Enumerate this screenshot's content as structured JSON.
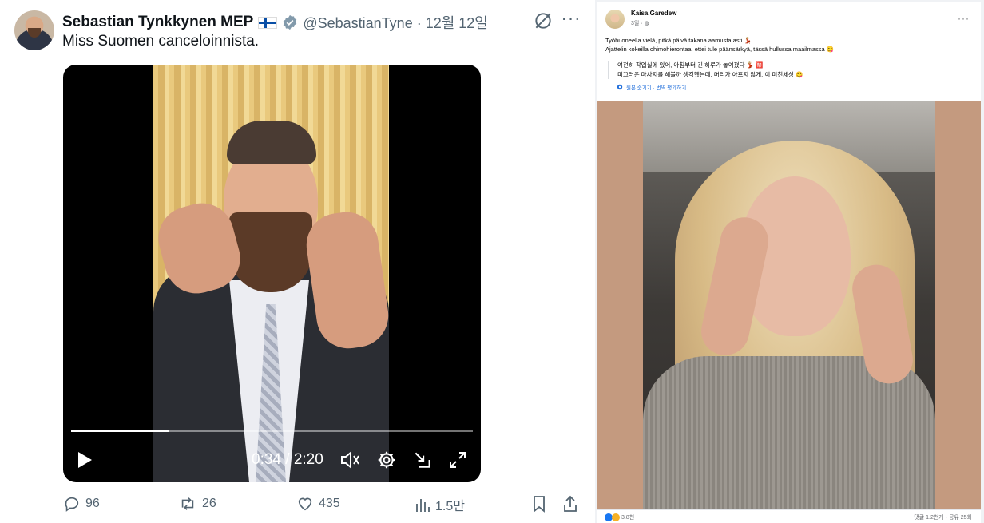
{
  "tweet": {
    "author_name": "Sebastian Tynkkynen MEP",
    "handle_date": "@SebastianTyne · 12월 12일",
    "text": "Miss Suomen canceloinnista.",
    "video": {
      "time": "0:34 / 2:20",
      "progress": 0.243
    },
    "actions": {
      "replies": "96",
      "reposts": "26",
      "likes": "435",
      "views": "1.5만"
    },
    "accent_color": "#1d9bf0"
  },
  "facebook": {
    "author_name": "Kaisa Garedew",
    "time": "3일 ·",
    "text_line1": "Työhuoneella vielä, pitkä päivä takana aamusta asti 💃🏼",
    "text_line2": "Ajattelin kokeilla ohimohierontaa, ettei tule päänsärkyä, tässä hullussa maailmassa 😋",
    "translation_line1": "여전히 작업실에 있어, 아침부터 긴 하루가 놓여졌다 💃🏼 🈲",
    "translation_line2": "미끄러운 마사지를 해볼까 생각했는데, 머리가 아프지 않게, 이 미친세상 😋",
    "translation_link": "원본 숨기기 · 번역 평가하기",
    "reactions": "3.8천",
    "stats": "댓글 1.2천개 · 공유 25회"
  }
}
